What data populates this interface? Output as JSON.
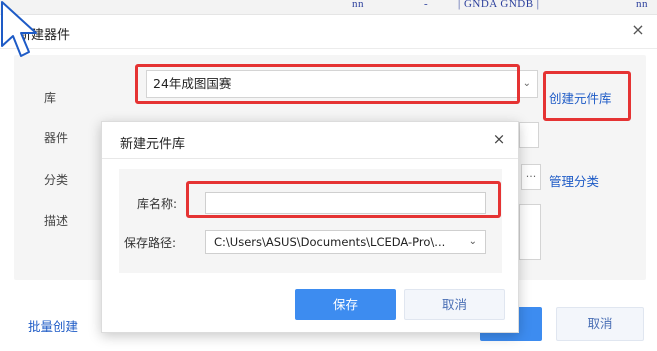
{
  "background_toolbar": {
    "ghost_text_1": "nn",
    "ghost_text_2": "-",
    "ghost_text_3": "| GNDA   GNDB |",
    "ghost_text_4": "nn"
  },
  "outer_dialog": {
    "title": "新建器件",
    "close_glyph": "×",
    "fields": {
      "library_label": "库",
      "library_value": "24年成图国赛",
      "device_label": "器件",
      "category_label": "分类",
      "description_label": "描述"
    },
    "create_library_link": "创建元件库",
    "manage_category_link": "管理分类",
    "ellipsis": "···",
    "bulk_create_link": "批量创建",
    "cancel_label": "取消"
  },
  "inner_dialog": {
    "title": "新建元件库",
    "close_glyph": "×",
    "name_label": "库名称:",
    "name_value": "",
    "path_label": "保存路径:",
    "path_value": "C:\\Users\\ASUS\\Documents\\LCEDA-Pro\\...",
    "save_label": "保存",
    "cancel_label": "取消"
  },
  "colors": {
    "accent": "#3d8cf0",
    "link": "#1e5bc6",
    "highlight": "#e53333"
  },
  "icons": {
    "chevron": "chevron-down-icon",
    "close": "close-icon",
    "cursor": "mouse-cursor-icon"
  }
}
